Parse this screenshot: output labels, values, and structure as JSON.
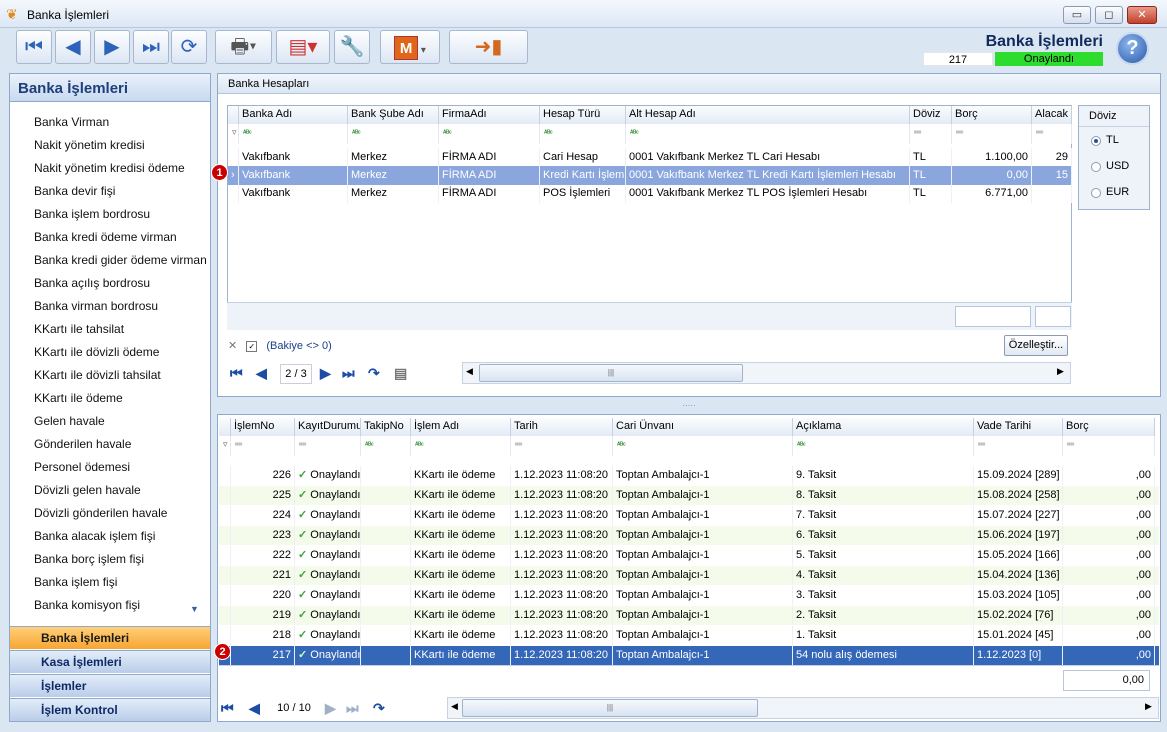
{
  "window": {
    "title": "Banka İşlemleri",
    "buttons": {
      "min": "▭",
      "max": "◻",
      "close": "✕"
    }
  },
  "header": {
    "title": "Banka İşlemleri",
    "record_no": "217",
    "status": "Onaylandı",
    "help": "?"
  },
  "toolbar": {
    "mailbox_letter": "M"
  },
  "sidebar": {
    "title": "Banka İşlemleri",
    "items": [
      "Banka Virman",
      "Nakit yönetim kredisi",
      "Nakit yönetim kredisi ödeme",
      "Banka devir fişi",
      "Banka işlem bordrosu",
      "Banka kredi ödeme virman",
      "Banka kredi gider ödeme virman",
      "Banka açılış bordrosu",
      "Banka virman bordrosu",
      "KKartı ile tahsilat",
      "KKartı ile dövizli ödeme",
      "KKartı ile dövizli tahsilat",
      "KKartı ile ödeme",
      "Gelen havale",
      "Gönderilen havale",
      "Personel ödemesi",
      "Dövizli gelen havale",
      "Dövizli gönderilen havale",
      "Banka alacak işlem fişi",
      "Banka borç işlem fişi",
      "Banka işlem fişi",
      "Banka komisyon fişi"
    ],
    "groups": [
      "Banka İşlemleri",
      "Kasa İşlemleri",
      "İşlemler",
      "İşlem Kontrol"
    ]
  },
  "accounts": {
    "panel_title": "Banka Hesapları",
    "columns": [
      "Banka Adı",
      "Bank Şube Adı",
      "FirmaAdı",
      "Hesap Türü",
      "Alt Hesap Adı",
      "Döviz",
      "Borç",
      "Alacak"
    ],
    "rows": [
      [
        "Vakıfbank",
        "Merkez",
        "FİRMA ADI",
        "Cari Hesap",
        "0001 Vakıfbank Merkez TL Cari Hesabı",
        "TL",
        "1.100,00",
        "29"
      ],
      [
        "Vakıfbank",
        "Merkez",
        "FİRMA ADI",
        "Kredi Kartı İşlemleri",
        "0001 Vakıfbank Merkez TL Kredi Kartı İşlemleri Hesabı",
        "TL",
        "0,00",
        "15"
      ],
      [
        "Vakıfbank",
        "Merkez",
        "FİRMA ADI",
        "POS İşlemleri",
        "0001 Vakıfbank Merkez TL POS İşlemleri Hesabı",
        "TL",
        "6.771,00",
        ""
      ]
    ],
    "filter_text": "(Bakiye <> 0)",
    "customize_button": "Özelleştir...",
    "pager": "2 / 3",
    "currency_group": {
      "title": "Döviz",
      "options": [
        "TL",
        "USD",
        "EUR"
      ],
      "selected": "TL"
    },
    "badge": "1"
  },
  "transactions": {
    "columns": [
      "İşlemNo",
      "KayıtDurumu",
      "TakipNo",
      "İşlem Adı",
      "Tarih",
      "Cari Ünvanı",
      "Açıklama",
      "Vade Tarihi",
      "Borç"
    ],
    "rows": [
      [
        "226",
        "Onaylandı",
        "",
        "KKartı ile ödeme",
        "1.12.2023 11:08:20",
        "Toptan Ambalajcı-1",
        "9. Taksit",
        "15.09.2024 [289]",
        ",00"
      ],
      [
        "225",
        "Onaylandı",
        "",
        "KKartı ile ödeme",
        "1.12.2023 11:08:20",
        "Toptan Ambalajcı-1",
        "8. Taksit",
        "15.08.2024 [258]",
        ",00"
      ],
      [
        "224",
        "Onaylandı",
        "",
        "KKartı ile ödeme",
        "1.12.2023 11:08:20",
        "Toptan Ambalajcı-1",
        "7. Taksit",
        "15.07.2024 [227]",
        ",00"
      ],
      [
        "223",
        "Onaylandı",
        "",
        "KKartı ile ödeme",
        "1.12.2023 11:08:20",
        "Toptan Ambalajcı-1",
        "6. Taksit",
        "15.06.2024 [197]",
        ",00"
      ],
      [
        "222",
        "Onaylandı",
        "",
        "KKartı ile ödeme",
        "1.12.2023 11:08:20",
        "Toptan Ambalajcı-1",
        "5. Taksit",
        "15.05.2024 [166]",
        ",00"
      ],
      [
        "221",
        "Onaylandı",
        "",
        "KKartı ile ödeme",
        "1.12.2023 11:08:20",
        "Toptan Ambalajcı-1",
        "4. Taksit",
        "15.04.2024 [136]",
        ",00"
      ],
      [
        "220",
        "Onaylandı",
        "",
        "KKartı ile ödeme",
        "1.12.2023 11:08:20",
        "Toptan Ambalajcı-1",
        "3. Taksit",
        "15.03.2024 [105]",
        ",00"
      ],
      [
        "219",
        "Onaylandı",
        "",
        "KKartı ile ödeme",
        "1.12.2023 11:08:20",
        "Toptan Ambalajcı-1",
        "2. Taksit",
        "15.02.2024 [76]",
        ",00"
      ],
      [
        "218",
        "Onaylandı",
        "",
        "KKartı ile ödeme",
        "1.12.2023 11:08:20",
        "Toptan Ambalajcı-1",
        "1. Taksit",
        "15.01.2024 [45]",
        ",00"
      ],
      [
        "217",
        "Onaylandı",
        "",
        "KKartı ile ödeme",
        "1.12.2023 11:08:20",
        "Toptan Ambalajcı-1",
        "54 nolu alış ödemesi",
        "1.12.2023 [0]",
        ",00"
      ]
    ],
    "total": "0,00",
    "pager": "10 / 10",
    "badge": "2"
  }
}
